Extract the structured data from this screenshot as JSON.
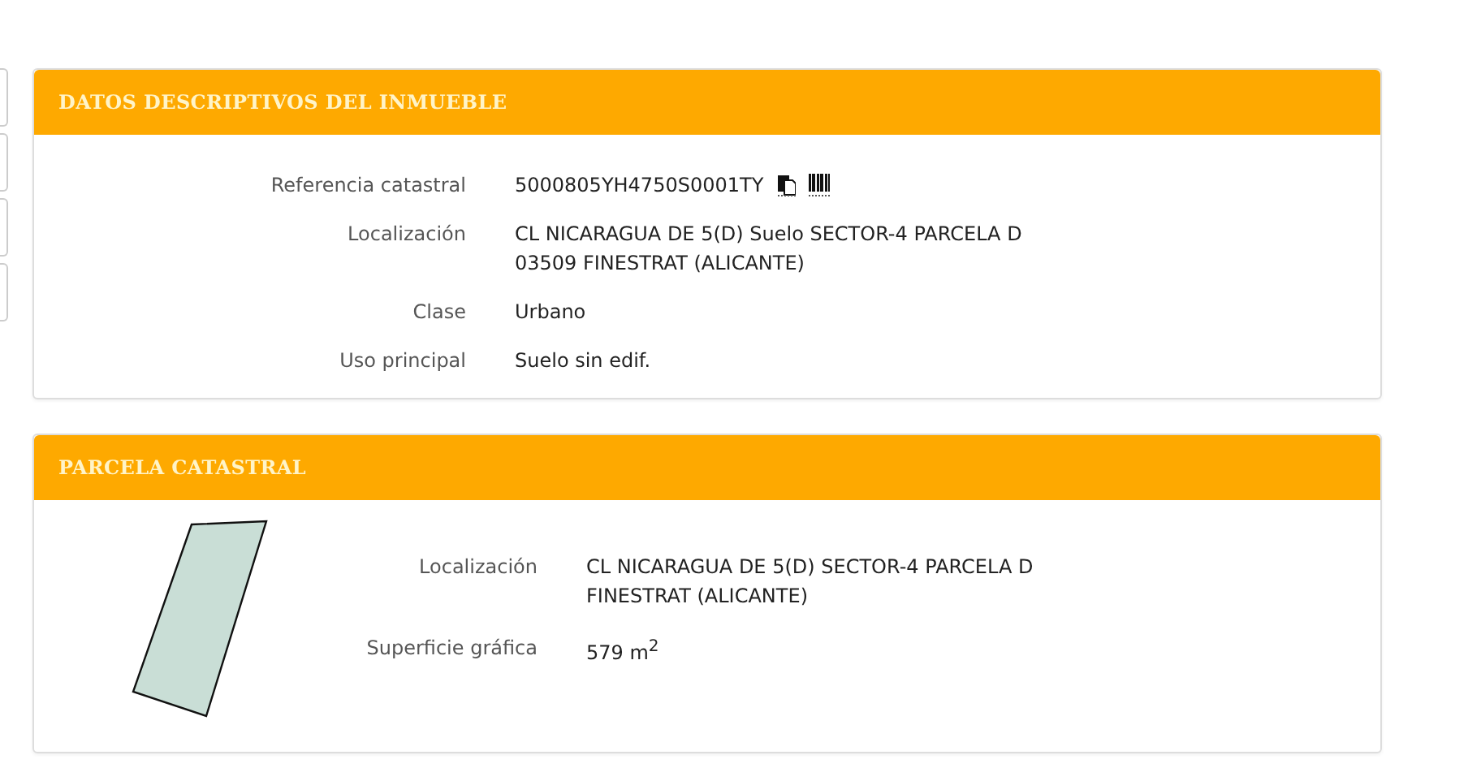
{
  "sections": [
    {
      "title": "DATOS DESCRIPTIVOS DEL INMUEBLE",
      "kind": "details",
      "fields": [
        {
          "kind": "reference",
          "label": "Referencia catastral",
          "lines": [
            "5000805YH4750S0001TY"
          ]
        },
        {
          "kind": "text",
          "label": "Localización",
          "lines": [
            "CL NICARAGUA DE 5(D) Suelo SECTOR-4 PARCELA D",
            "03509 FINESTRAT (ALICANTE)"
          ]
        },
        {
          "kind": "text",
          "label": "Clase",
          "lines": [
            "Urbano"
          ]
        },
        {
          "kind": "text",
          "label": "Uso principal",
          "lines": [
            "Suelo sin edif."
          ]
        }
      ]
    },
    {
      "title": "PARCELA CATASTRAL",
      "kind": "parcel",
      "fields": [
        {
          "kind": "text",
          "label": "Localización",
          "lines": [
            "CL NICARAGUA DE 5(D) SECTOR-4 PARCELA D",
            "FINESTRAT (ALICANTE)"
          ]
        },
        {
          "kind": "text",
          "label": "Superficie gráfica",
          "lines": [
            "579 m$^{2}$"
          ]
        }
      ]
    }
  ]
}
